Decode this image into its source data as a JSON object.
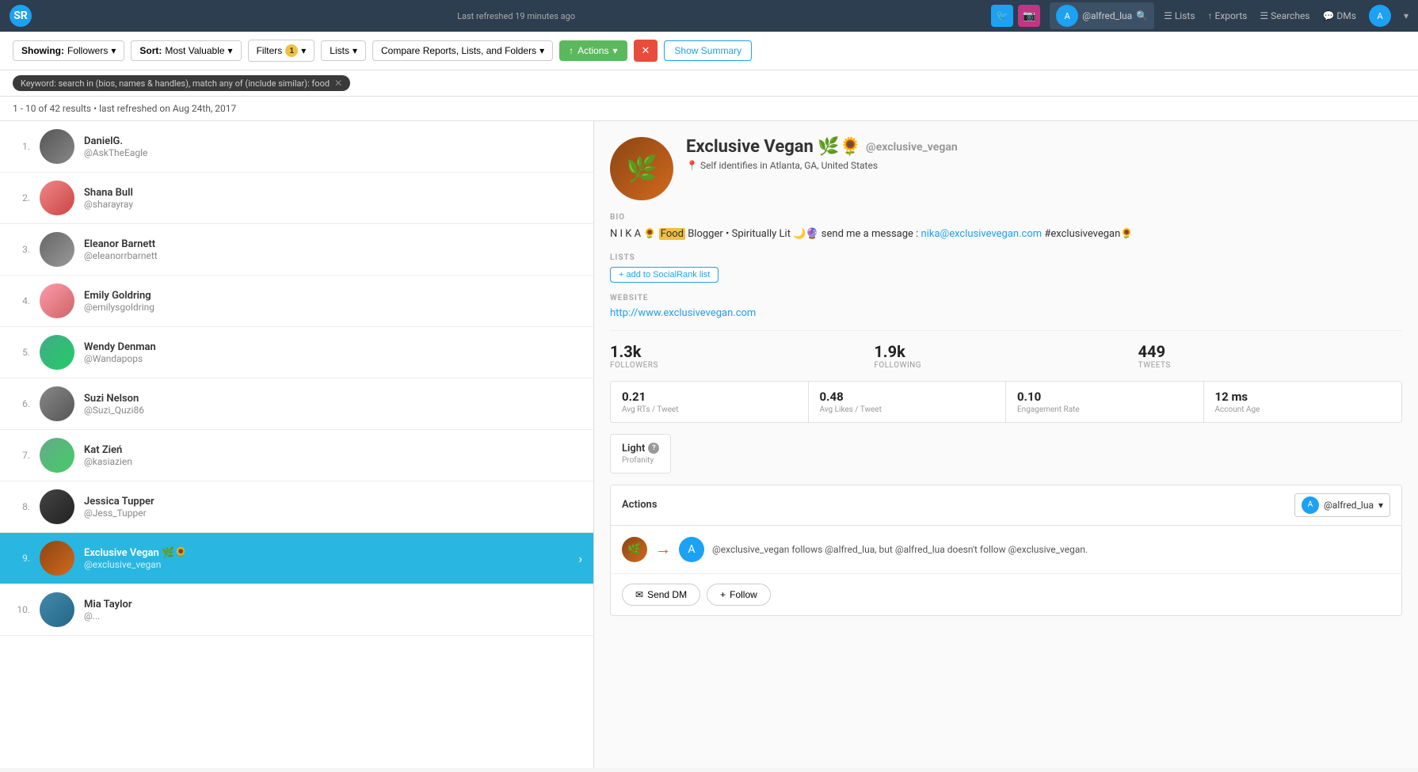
{
  "app": {
    "logo": "SR",
    "refresh_text": "Last refreshed 19 minutes ago"
  },
  "topnav": {
    "twitter_icon": "🐦",
    "instagram_icon": "📷",
    "handle": "@alfred_lua",
    "search_placeholder": "Search",
    "links": [
      "Lists",
      "Exports",
      "Searches",
      "DMs"
    ]
  },
  "toolbar": {
    "showing_label": "Showing:",
    "showing_value": "Followers",
    "sort_label": "Sort:",
    "sort_value": "Most Valuable",
    "filters_label": "Filters",
    "filters_badge": "1",
    "lists_label": "Lists",
    "compare_label": "Compare Reports, Lists, and Folders",
    "actions_label": "Actions",
    "clear_label": "✕",
    "show_summary_label": "Show Summary"
  },
  "filter_tag": {
    "text": "Keyword: search in (bios, names & handles), match any of (include similar): food"
  },
  "results": {
    "range": "1 - 10 of 42 results",
    "refresh_text": "• last refreshed on Aug 24th, 2017"
  },
  "list_items": [
    {
      "rank": "1.",
      "name": "DanielG.",
      "username": "@AskTheEagle",
      "avatar_class": "avatar-daniel",
      "active": false
    },
    {
      "rank": "2.",
      "name": "Shana Bull",
      "username": "@sharayray",
      "avatar_class": "avatar-shana",
      "active": false
    },
    {
      "rank": "3.",
      "name": "Eleanor Barnett",
      "username": "@eleanorrbarnett",
      "avatar_class": "avatar-eleanor",
      "active": false
    },
    {
      "rank": "4.",
      "name": "Emily Goldring",
      "username": "@emilysgoldring",
      "avatar_class": "avatar-emily",
      "active": false
    },
    {
      "rank": "5.",
      "name": "Wendy Denman",
      "username": "@Wandapops",
      "avatar_class": "avatar-wendy",
      "active": false
    },
    {
      "rank": "6.",
      "name": "Suzi Nelson",
      "username": "@Suzi_Quzi86",
      "avatar_class": "avatar-suzi",
      "active": false
    },
    {
      "rank": "7.",
      "name": "Kat Zień",
      "username": "@kasiazien",
      "avatar_class": "avatar-kat",
      "active": false
    },
    {
      "rank": "8.",
      "name": "Jessica Tupper",
      "username": "@Jess_Tupper",
      "avatar_class": "avatar-jessica",
      "active": false
    },
    {
      "rank": "9.",
      "name": "Exclusive Vegan 🌿🌻",
      "username": "@exclusive_vegan",
      "avatar_class": "avatar-exclusive",
      "active": true
    },
    {
      "rank": "10.",
      "name": "Mia Taylor",
      "username": "@...",
      "avatar_class": "avatar-mia",
      "active": false
    }
  ],
  "profile": {
    "name": "Exclusive Vegan 🌿🌻",
    "handle": "@exclusive_vegan",
    "location": "Self identifies in Atlanta, GA, United States",
    "bio_prefix": "N I K A 🌻 ",
    "bio_highlight": "Food",
    "bio_suffix": " Blogger • Spiritually Lit 🌙🔮 send me a message : ",
    "bio_email": "nika@exclusivevegan.com",
    "bio_hashtag": " #exclusivevegan🌻",
    "lists_btn": "+ add to SocialRank list",
    "website_label": "WEBSITE",
    "website_url": "http://www.exclusivevegan.com",
    "followers_val": "1.3k",
    "followers_lbl": "FOLLOWERS",
    "following_val": "1.9k",
    "following_lbl": "FOLLOWING",
    "tweets_val": "449",
    "tweets_lbl": "TWEETS",
    "avg_rts": "0.21",
    "avg_rts_lbl": "Avg RTs / Tweet",
    "avg_likes": "0.48",
    "avg_likes_lbl": "Avg Likes / Tweet",
    "engagement": "0.10",
    "engagement_lbl": "Engagement Rate",
    "account_age": "12 ms",
    "account_age_lbl": "Account Age",
    "profanity_val": "Light",
    "profanity_lbl": "Profanity",
    "bio_label": "BIO",
    "lists_label": "LISTS"
  },
  "actions_panel": {
    "title": "Actions",
    "account": "@alfred_lua",
    "message": "@exclusive_vegan follows @alfred_lua, but @alfred_lua doesn't follow @exclusive_vegan.",
    "send_dm_label": "Send DM",
    "follow_label": "Follow"
  }
}
